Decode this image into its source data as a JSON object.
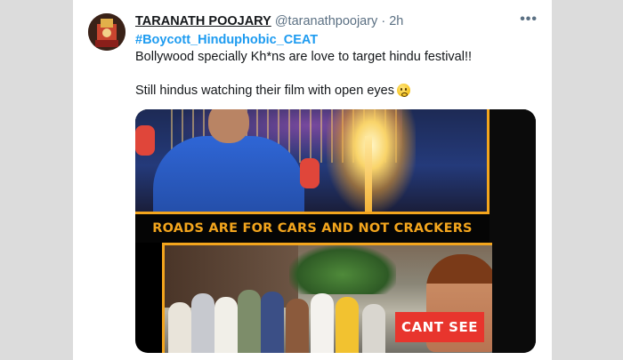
{
  "tweet": {
    "author_name": "TARANATH POOJARY",
    "handle": "@taranathpoojary",
    "separator": "·",
    "time": "2h",
    "more_glyph": "•••",
    "hashtag": "#Boycott_Hinduphobic_CEAT",
    "line1": "Bollywood specially Kh*ns are love to target hindu festival!!",
    "line2": "Still hindus watching their film with open eyes",
    "emoji_name": "flushed-face-emoji"
  },
  "media": {
    "slogan": "ROADS ARE FOR CARS AND NOT CRACKERS",
    "badge": "CANT SEE",
    "colors": {
      "accent_orange": "#f3a51d",
      "badge_red": "#e8352d",
      "hashtag_blue": "#1d9bf0"
    }
  }
}
